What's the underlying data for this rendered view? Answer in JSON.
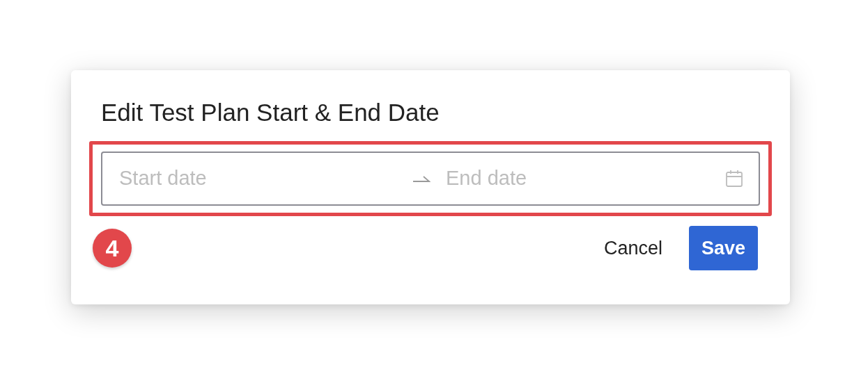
{
  "dialog": {
    "title": "Edit Test Plan Start & End Date",
    "date_range": {
      "start_placeholder": "Start date",
      "end_placeholder": "End date",
      "highlighted": true
    },
    "step_badge": "4",
    "buttons": [
      {
        "kind": "link",
        "label": "Cancel"
      },
      {
        "kind": "primary",
        "label": "Save"
      }
    ]
  }
}
